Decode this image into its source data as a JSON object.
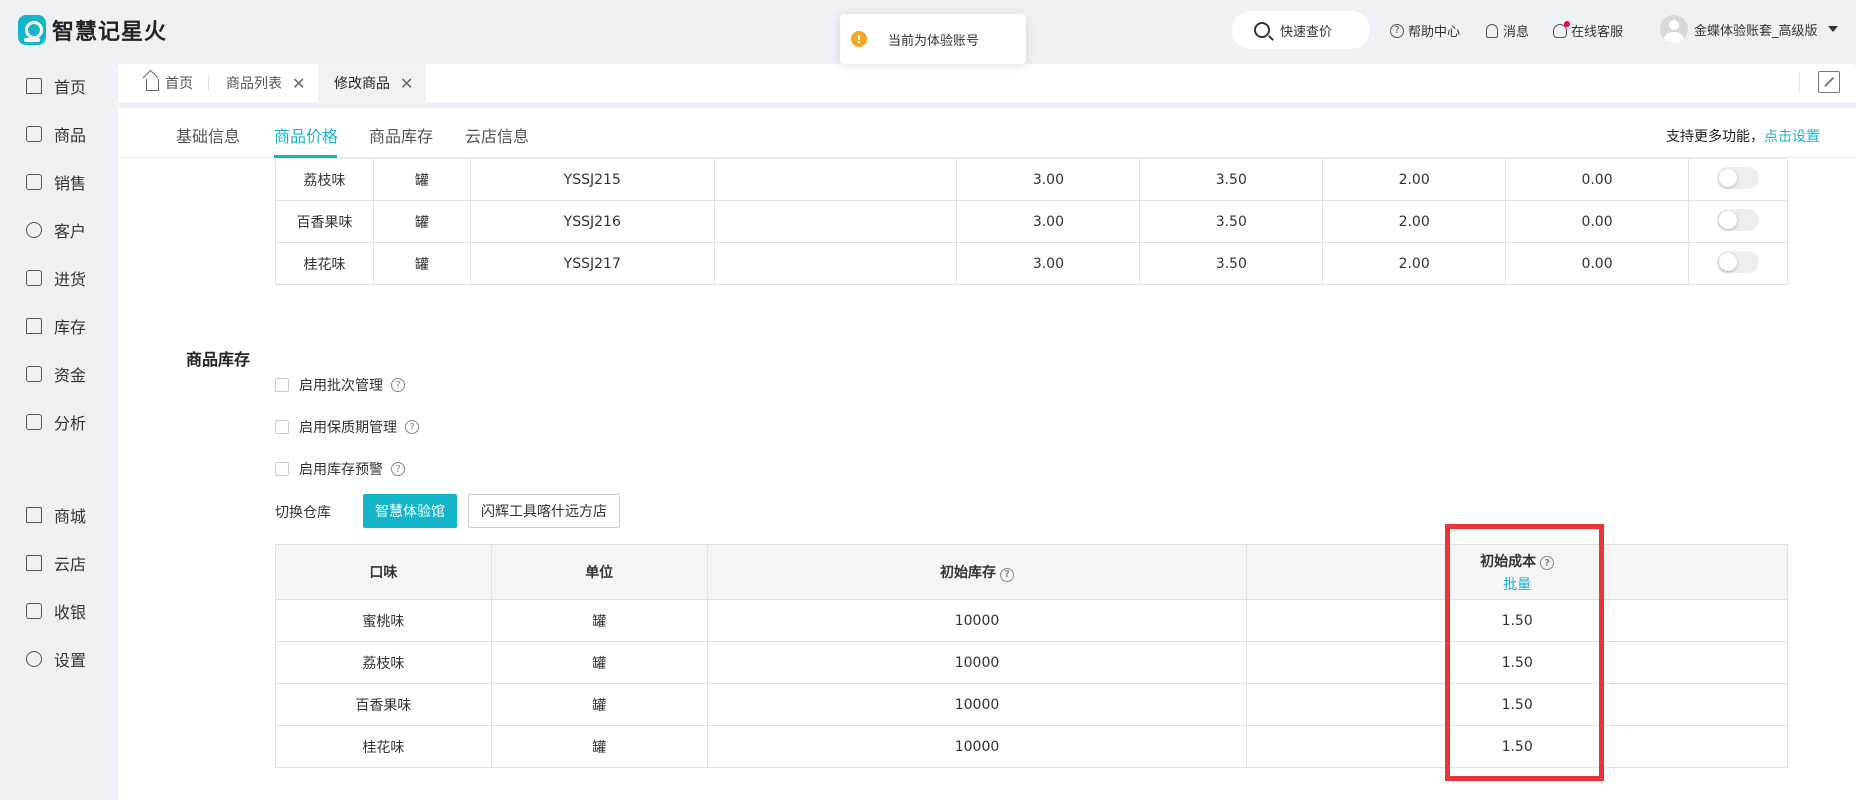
{
  "app": {
    "title": "智慧记星火"
  },
  "toast": {
    "text": "当前为体验账号",
    "icon": "!"
  },
  "header": {
    "search_label": "快速查价",
    "help": "帮助中心",
    "messages": "消息",
    "support": "在线客服",
    "user": "金蝶体验账套_高级版"
  },
  "sidebar": {
    "items": [
      {
        "label": "首页",
        "icon": "home-icon"
      },
      {
        "label": "商品",
        "icon": "bag-icon"
      },
      {
        "label": "销售",
        "icon": "clipboard-icon"
      },
      {
        "label": "客户",
        "icon": "person-icon"
      },
      {
        "label": "进货",
        "icon": "book-icon"
      },
      {
        "label": "库存",
        "icon": "warehouse-icon"
      },
      {
        "label": "资金",
        "icon": "wallet-icon"
      },
      {
        "label": "分析",
        "icon": "chart-icon"
      },
      {
        "label": "商城",
        "icon": "mall-icon"
      },
      {
        "label": "云店",
        "icon": "store-icon"
      },
      {
        "label": "收银",
        "icon": "pos-icon"
      },
      {
        "label": "设置",
        "icon": "gear-icon"
      }
    ]
  },
  "tabs": [
    {
      "label": "首页"
    },
    {
      "label": "商品列表"
    },
    {
      "label": "修改商品"
    }
  ],
  "section_tabs": [
    {
      "label": "基础信息"
    },
    {
      "label": "商品价格"
    },
    {
      "label": "商品库存"
    },
    {
      "label": "云店信息"
    }
  ],
  "more_func": {
    "text": "支持更多功能，",
    "link": "点击设置"
  },
  "price_rows": [
    {
      "flavor": "荔枝味",
      "unit": "罐",
      "code": "YSSJ215",
      "extra": "",
      "p1": "3.00",
      "p2": "3.50",
      "p3": "2.00",
      "p4": "0.00"
    },
    {
      "flavor": "百香果味",
      "unit": "罐",
      "code": "YSSJ216",
      "extra": "",
      "p1": "3.00",
      "p2": "3.50",
      "p3": "2.00",
      "p4": "0.00"
    },
    {
      "flavor": "桂花味",
      "unit": "罐",
      "code": "YSSJ217",
      "extra": "",
      "p1": "3.00",
      "p2": "3.50",
      "p3": "2.00",
      "p4": "0.00"
    }
  ],
  "inventory": {
    "title": "商品库存",
    "options": [
      "启用批次管理",
      "启用保质期管理",
      "启用库存预警"
    ],
    "warehouse_label": "切换仓库",
    "warehouses": [
      "智慧体验馆",
      "闪辉工具喀什远方店"
    ],
    "headers": {
      "flavor": "口味",
      "unit": "单位",
      "initial_stock": "初始库存",
      "initial_cost": "初始成本",
      "batch": "批量"
    },
    "rows": [
      {
        "flavor": "蜜桃味",
        "unit": "罐",
        "stock": "10000",
        "cost": "1.50"
      },
      {
        "flavor": "荔枝味",
        "unit": "罐",
        "stock": "10000",
        "cost": "1.50"
      },
      {
        "flavor": "百香果味",
        "unit": "罐",
        "stock": "10000",
        "cost": "1.50"
      },
      {
        "flavor": "桂花味",
        "unit": "罐",
        "stock": "10000",
        "cost": "1.50"
      }
    ]
  },
  "colors": {
    "accent": "#14b5c8",
    "highlight": "#e8343a",
    "toast_icon": "#f5a623"
  }
}
